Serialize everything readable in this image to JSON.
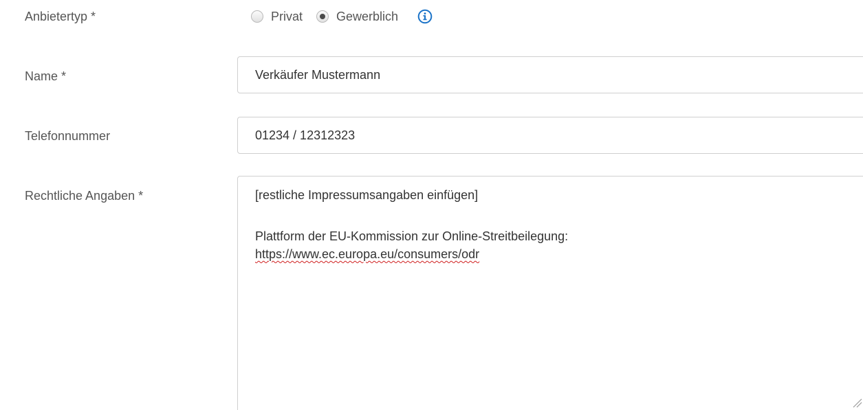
{
  "form": {
    "provider_type": {
      "label": "Anbietertyp *",
      "options": [
        {
          "label": "Privat",
          "checked": false
        },
        {
          "label": "Gewerblich",
          "checked": true
        }
      ],
      "info_icon": "info-circle-icon",
      "info_color": "#1a73c8"
    },
    "name": {
      "label": "Name *",
      "value": "Verkäufer Mustermann"
    },
    "phone": {
      "label": "Telefonnummer",
      "value": "01234 / 12312323"
    },
    "legal": {
      "label": "Rechtliche Angaben *",
      "lines": [
        "[restliche Impressumsangaben einfügen]",
        "Plattform der EU-Kommission zur Online-Streitbeilegung:",
        "https://www.ec.europa.eu/consumers/odr"
      ]
    }
  }
}
